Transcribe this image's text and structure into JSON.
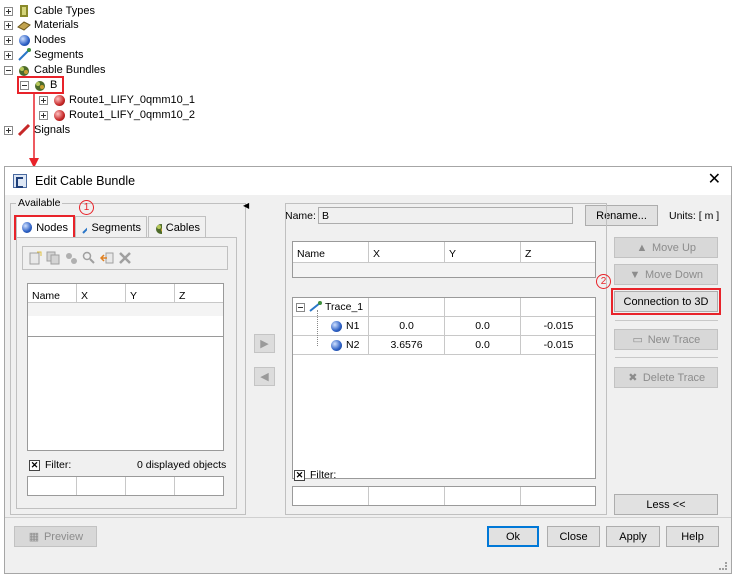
{
  "tree": {
    "items": [
      {
        "label": "Cable Types",
        "icon": "cable-type-icon"
      },
      {
        "label": "Materials",
        "icon": "material-icon"
      },
      {
        "label": "Nodes",
        "icon": "node-sphere-icon"
      },
      {
        "label": "Segments",
        "icon": "segment-icon"
      },
      {
        "label": "Cable Bundles",
        "icon": "cable-bundle-icon"
      },
      {
        "label": "B",
        "icon": "bundle-item-icon"
      },
      {
        "label": "Route1_LIFY_0qmm10_1",
        "icon": "route-icon"
      },
      {
        "label": "Route1_LIFY_0qmm10_2",
        "icon": "route-icon"
      },
      {
        "label": "Signals",
        "icon": "signal-icon"
      }
    ]
  },
  "dialog": {
    "title": "Edit Cable Bundle",
    "close_glyph": "✕",
    "available_label": "Available",
    "tabs": [
      {
        "label": "Nodes"
      },
      {
        "label": "Segments"
      },
      {
        "label": "Cables"
      }
    ],
    "left_table": {
      "headers": [
        "Name",
        "X",
        "Y",
        "Z"
      ]
    },
    "left_filter_label": "Filter:",
    "left_count": "0 displayed objects",
    "name_label": "Name:",
    "name_value": "B",
    "rename_button": "Rename...",
    "units_label": "Units: [ m ]",
    "right_table": {
      "headers": [
        "Name",
        "X",
        "Y",
        "Z"
      ],
      "trace_label": "Trace_1",
      "rows": [
        {
          "name": "N1",
          "x": "0.0",
          "y": "0.0",
          "z": "-0.015"
        },
        {
          "name": "N2",
          "x": "3.6576",
          "y": "0.0",
          "z": "-0.015"
        }
      ]
    },
    "right_filter_label": "Filter:",
    "side_buttons": {
      "move_up": "Move Up",
      "move_down": "Move Down",
      "connection_3d": "Connection to 3D",
      "new_trace": "New Trace",
      "delete_trace": "Delete Trace",
      "less": "Less <<"
    },
    "footer": {
      "preview": "Preview",
      "ok": "Ok",
      "close": "Close",
      "apply": "Apply",
      "help": "Help"
    },
    "annotations": {
      "one": "1",
      "two": "2"
    }
  },
  "colors": {
    "highlight_red": "#e8232a",
    "default_button_blue": "#0078d7"
  }
}
